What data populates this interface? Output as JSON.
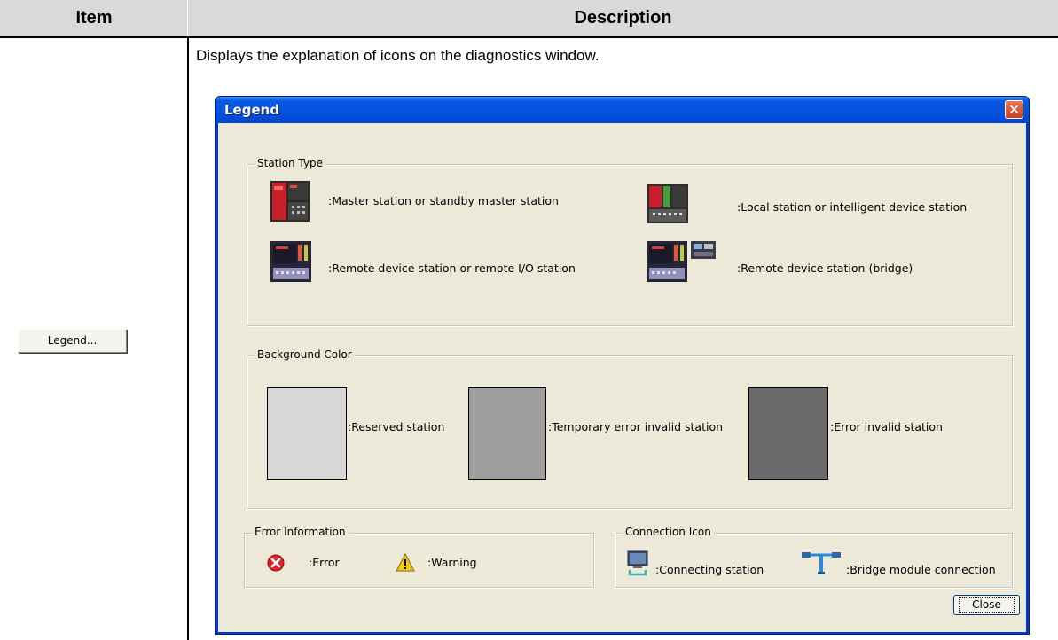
{
  "table": {
    "header_item": "Item",
    "header_description": "Description",
    "row_description": "Displays the explanation of icons on the diagnostics window.",
    "legend_button_label": "Legend..."
  },
  "dialog": {
    "title": "Legend",
    "close_x": "×",
    "close_button_label": "Close",
    "station_type": {
      "title": "Station Type",
      "master": ":Master station or standby master station",
      "local": ":Local station or intelligent device station",
      "remote_device": ":Remote device station or remote I/O station",
      "remote_bridge": ":Remote device station (bridge)"
    },
    "background_color": {
      "title": "Background Color",
      "reserved": ":Reserved station",
      "reserved_color": "#d8d8d8",
      "temporary_error": ":Temporary error invalid station",
      "temporary_error_color": "#9e9e9e",
      "error_invalid": ":Error invalid station",
      "error_invalid_color": "#6a6a6a"
    },
    "error_information": {
      "title": "Error Information",
      "error": ":Error",
      "warning": ":Warning"
    },
    "connection_icon": {
      "title": "Connection Icon",
      "connecting": ":Connecting station",
      "bridge": ":Bridge module connection"
    }
  }
}
